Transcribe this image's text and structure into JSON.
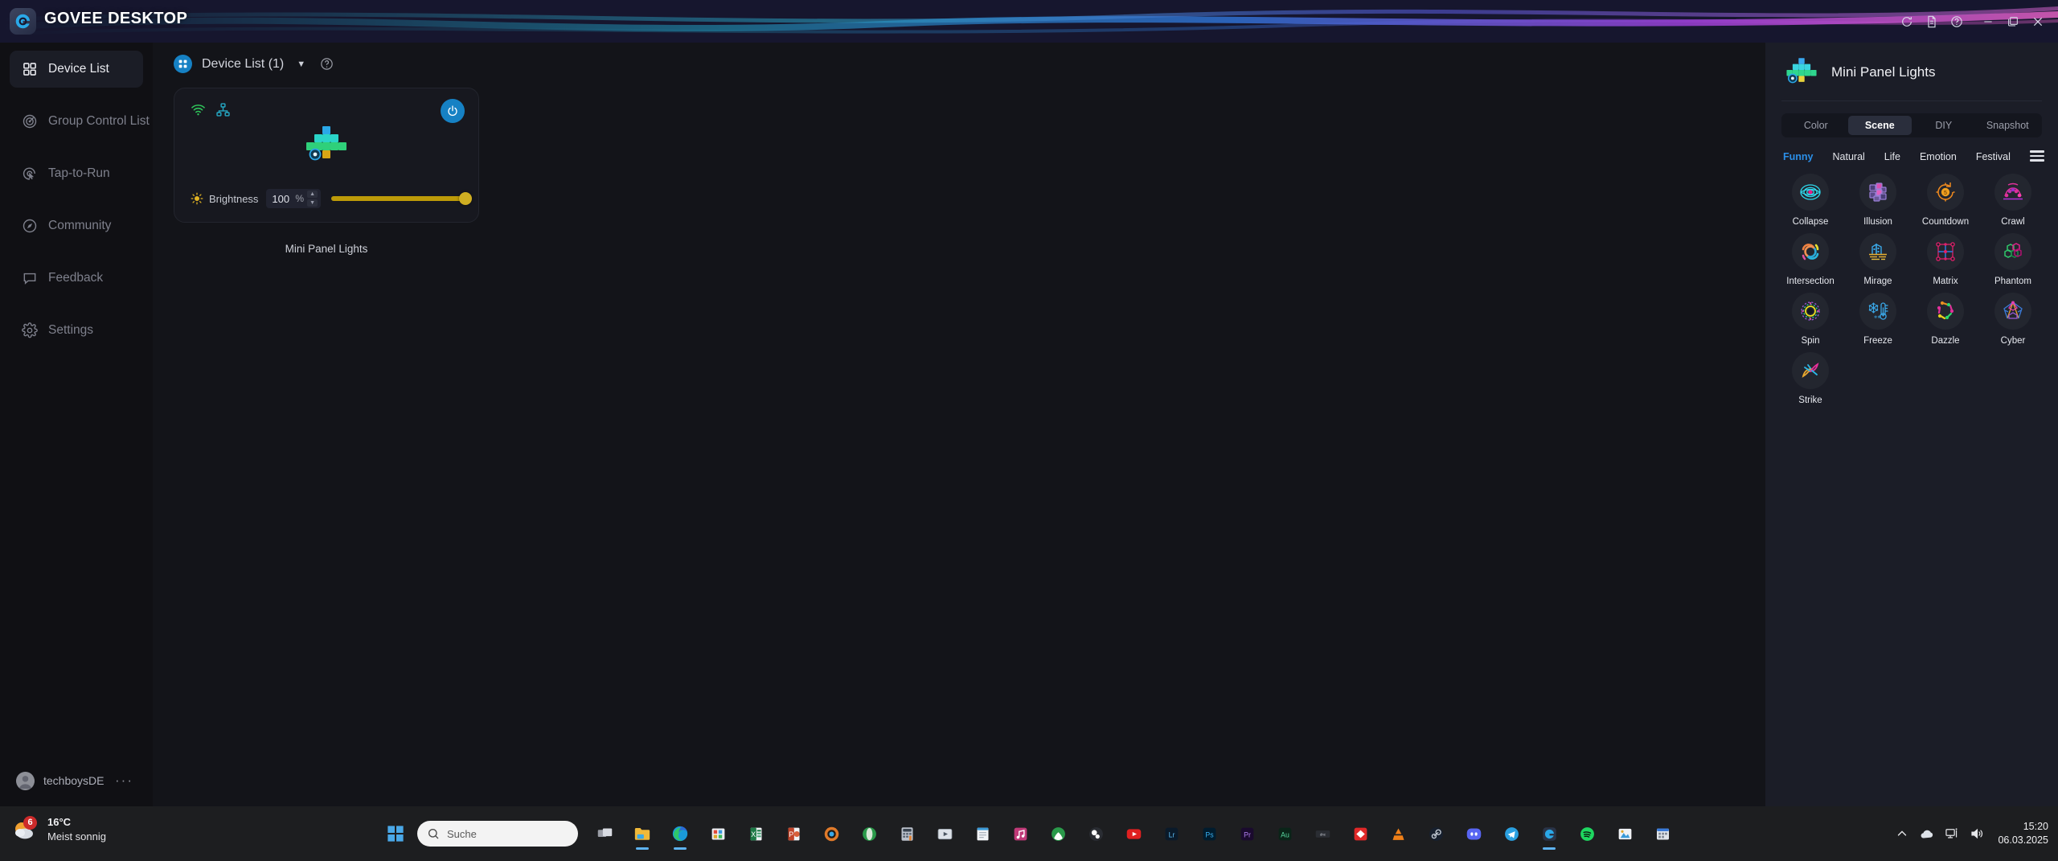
{
  "titlebar": {
    "app_title": "GOVEE DESKTOP",
    "logo_icon": "govee-g-logo",
    "controls": [
      {
        "name": "refresh-icon",
        "label": "Refresh"
      },
      {
        "name": "log-icon",
        "label": "Log"
      },
      {
        "name": "help-icon",
        "label": "Help"
      },
      {
        "name": "minimize-icon",
        "label": "Minimize"
      },
      {
        "name": "maximize-icon",
        "label": "Maximize"
      },
      {
        "name": "close-icon",
        "label": "Close"
      }
    ]
  },
  "sidebar": {
    "items": [
      {
        "label": "Device List",
        "icon": "grid-icon",
        "active": true
      },
      {
        "label": "Group Control List",
        "icon": "target-icon",
        "active": false
      },
      {
        "label": "Tap-to-Run",
        "icon": "cursor-tap-icon",
        "active": false
      },
      {
        "label": "Community",
        "icon": "compass-icon",
        "active": false
      },
      {
        "label": "Feedback",
        "icon": "chat-icon",
        "active": false
      },
      {
        "label": "Settings",
        "icon": "gear-icon",
        "active": false
      }
    ],
    "user": {
      "name": "techboysDE",
      "more": "···",
      "avatar_icon": "user-avatar"
    }
  },
  "main": {
    "header": {
      "badge_icon": "grid-icon",
      "title": "Device List (1)",
      "caret_icon": "chevron-down-icon",
      "help_icon": "question-circle-icon"
    },
    "device_card": {
      "wifi_icon": "wifi-icon",
      "lan_icon": "lan-icon",
      "power_icon": "power-icon",
      "name": "Mini Panel Lights",
      "brightness": {
        "icon": "brightness-icon",
        "label": "Brightness",
        "value": "100",
        "unit": "%",
        "percent": 100
      }
    }
  },
  "right_panel": {
    "device_name": "Mini Panel Lights",
    "device_icon": "mini-panel-lights",
    "tabs": [
      {
        "label": "Color",
        "active": false
      },
      {
        "label": "Scene",
        "active": true
      },
      {
        "label": "DIY",
        "active": false
      },
      {
        "label": "Snapshot",
        "active": false
      }
    ],
    "categories": [
      {
        "label": "Funny",
        "active": true
      },
      {
        "label": "Natural",
        "active": false
      },
      {
        "label": "Life",
        "active": false
      },
      {
        "label": "Emotion",
        "active": false
      },
      {
        "label": "Festival",
        "active": false
      }
    ],
    "menu_icon": "hamburger-icon",
    "scenes": [
      {
        "label": "Collapse",
        "icon": "collapse-icon"
      },
      {
        "label": "Illusion",
        "icon": "illusion-icon"
      },
      {
        "label": "Countdown",
        "icon": "countdown-icon"
      },
      {
        "label": "Crawl",
        "icon": "crawl-icon"
      },
      {
        "label": "Intersection",
        "icon": "intersection-icon"
      },
      {
        "label": "Mirage",
        "icon": "mirage-icon"
      },
      {
        "label": "Matrix",
        "icon": "matrix-icon"
      },
      {
        "label": "Phantom",
        "icon": "phantom-icon"
      },
      {
        "label": "Spin",
        "icon": "spin-icon"
      },
      {
        "label": "Freeze",
        "icon": "freeze-icon"
      },
      {
        "label": "Dazzle",
        "icon": "dazzle-icon"
      },
      {
        "label": "Cyber",
        "icon": "cyber-icon"
      },
      {
        "label": "Strike",
        "icon": "strike-icon"
      }
    ]
  },
  "taskbar": {
    "weather": {
      "badge": "6",
      "temperature": "16°C",
      "condition": "Meist sonnig"
    },
    "start_icon": "windows-start-icon",
    "search": {
      "placeholder": "Suche",
      "icon": "search-icon"
    },
    "apps": [
      {
        "name": "task-view",
        "active": false
      },
      {
        "name": "file-explorer",
        "active": true
      },
      {
        "name": "microsoft-edge",
        "active": true
      },
      {
        "name": "microsoft-store",
        "active": false
      },
      {
        "name": "microsoft-excel",
        "active": false
      },
      {
        "name": "microsoft-powerpoint",
        "active": false
      },
      {
        "name": "camera-app",
        "active": false
      },
      {
        "name": "opera-browser",
        "active": false
      },
      {
        "name": "calculator-app",
        "active": false
      },
      {
        "name": "video-editor",
        "active": false
      },
      {
        "name": "notepad-app",
        "active": false
      },
      {
        "name": "music-app",
        "active": false
      },
      {
        "name": "xbox-app",
        "active": false
      },
      {
        "name": "obs-studio",
        "active": false
      },
      {
        "name": "youtube-app",
        "active": false
      },
      {
        "name": "lightroom",
        "active": false
      },
      {
        "name": "photoshop",
        "active": false
      },
      {
        "name": "premiere-pro",
        "active": false
      },
      {
        "name": "audition",
        "active": false
      },
      {
        "name": "davinci-resolve",
        "active": false
      },
      {
        "name": "anydesk",
        "active": false
      },
      {
        "name": "vlc-player",
        "active": false
      },
      {
        "name": "steam-app",
        "active": false
      },
      {
        "name": "discord-app",
        "active": false
      },
      {
        "name": "telegram-app",
        "active": false
      },
      {
        "name": "govee-desktop",
        "active": true
      },
      {
        "name": "spotify-app",
        "active": false
      },
      {
        "name": "photos-app",
        "active": false
      },
      {
        "name": "calendar-app",
        "active": false
      }
    ],
    "tray": [
      {
        "name": "show-hidden-icons-icon"
      },
      {
        "name": "onedrive-icon"
      },
      {
        "name": "network-icon"
      },
      {
        "name": "volume-icon"
      }
    ],
    "clock": {
      "time": "15:20",
      "date": "06.03.2025"
    }
  }
}
